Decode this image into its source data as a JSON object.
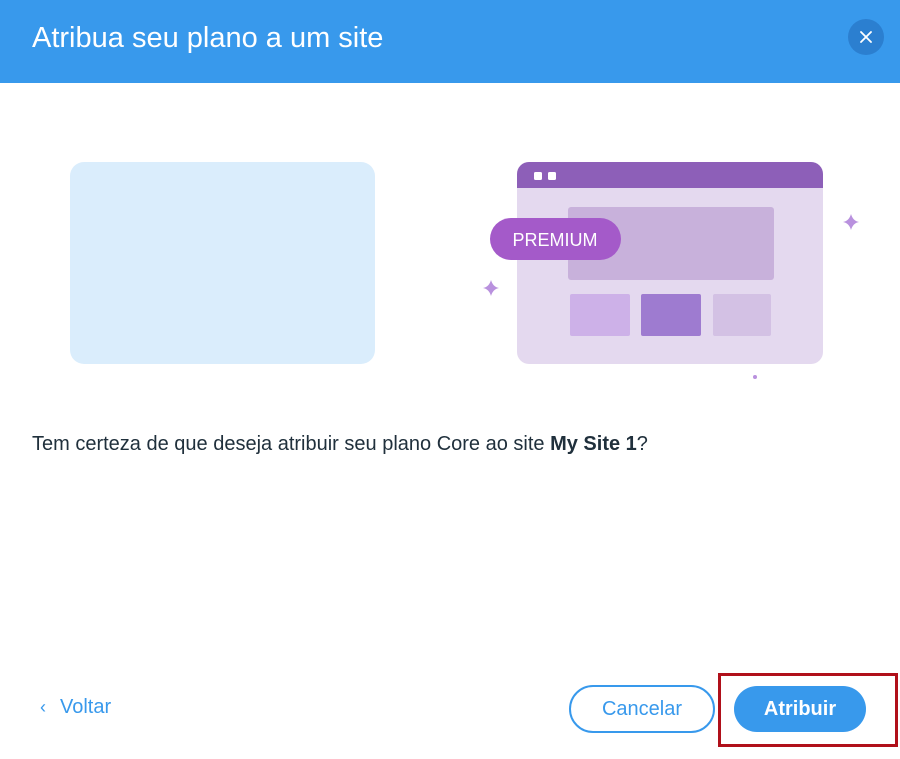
{
  "dialog": {
    "title": "Atribua seu plano a um site",
    "close_icon": "close-icon",
    "message": {
      "prefix": "Tem certeza de que deseja atribuir seu plano Core ao site ",
      "site_name": "My Site 1",
      "suffix": "?"
    },
    "illustration": {
      "badge_text": "PREMIUM"
    },
    "footer": {
      "back_label": "Voltar",
      "back_icon": "chevron-left-icon",
      "cancel_label": "Cancelar",
      "assign_label": "Atribuir"
    }
  },
  "colors": {
    "header": "#3899ec",
    "accent": "#3899ec",
    "premium_badge": "#a45ac9",
    "highlight_border": "#b0101a"
  }
}
